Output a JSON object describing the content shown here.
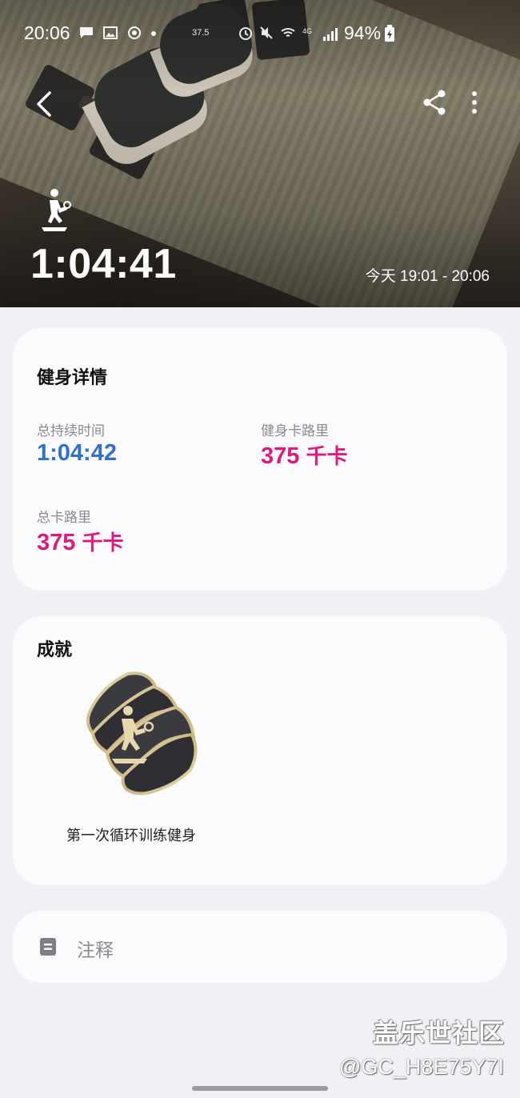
{
  "status_bar": {
    "time": "20:06",
    "battery": "94%",
    "icons": [
      "message-icon",
      "image-icon",
      "record-icon",
      "speed-icon",
      "alarm-icon",
      "mute-icon",
      "wifi-icon",
      "4g-icon",
      "signal-icon",
      "charging-icon"
    ]
  },
  "hero": {
    "duration": "1:04:41",
    "time_range": "今天 19:01 - 20:06",
    "workout_icon": "circuit-training-icon"
  },
  "details": {
    "title": "健身详情",
    "total_duration_label": "总持续时间",
    "total_duration_value": "1:04:42",
    "workout_calories_label": "健身卡路里",
    "workout_calories_value": "375",
    "workout_calories_unit": "千卡",
    "total_calories_label": "总卡路里",
    "total_calories_value": "375",
    "total_calories_unit": "千卡"
  },
  "achievements": {
    "title": "成就",
    "badge_caption": "第一次循环训练健身"
  },
  "notes": {
    "label": "注释"
  },
  "watermark": {
    "site": "盖乐世社区",
    "user": "@GC_H8E75Y7I"
  },
  "colors": {
    "duration_blue": "#2f6fd6",
    "calorie_pink": "#e0187f",
    "card_bg": "#fbfbfd",
    "page_bg": "#f1f0f5"
  }
}
